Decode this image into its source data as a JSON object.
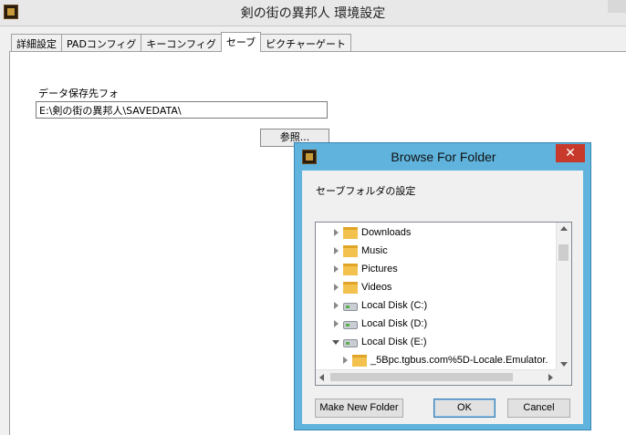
{
  "window": {
    "title": "剣の街の異邦人 環境設定",
    "icon": "app-icon"
  },
  "tabs": [
    {
      "label": "詳細設定",
      "active": false
    },
    {
      "label": "PADコンフィグ",
      "active": false
    },
    {
      "label": "キーコンフィグ",
      "active": false
    },
    {
      "label": "セーブ",
      "active": true
    },
    {
      "label": "ピクチャーゲート",
      "active": false
    }
  ],
  "save_tab": {
    "folder_label": "データ保存先フォ",
    "path_value": "E:\\剣の街の異邦人\\SAVEDATA\\",
    "browse_label": "参照..."
  },
  "dialog": {
    "title": "Browse For Folder",
    "close_glyph": "✕",
    "description": "セーブフォルダの設定",
    "tree": [
      {
        "label": "Downloads",
        "icon": "folder-icon",
        "expanded": false
      },
      {
        "label": "Music",
        "icon": "folder-icon",
        "expanded": false
      },
      {
        "label": "Pictures",
        "icon": "folder-icon",
        "expanded": false
      },
      {
        "label": "Videos",
        "icon": "folder-icon",
        "expanded": false
      },
      {
        "label": "Local Disk (C:)",
        "icon": "drive-icon",
        "expanded": false
      },
      {
        "label": "Local Disk (D:)",
        "icon": "drive-icon",
        "expanded": false
      },
      {
        "label": "Local Disk (E:)",
        "icon": "drive-icon",
        "expanded": true
      },
      {
        "label": "_5Bpc.tgbus.com%5D-Locale.Emulator.",
        "icon": "folder-icon",
        "expanded": false
      }
    ],
    "buttons": {
      "new_folder": "Make New Folder",
      "ok": "OK",
      "cancel": "Cancel"
    }
  },
  "colors": {
    "dialog_frame": "#5fb3dc",
    "close_button": "#c7392b",
    "folder": "#f2c14e"
  }
}
